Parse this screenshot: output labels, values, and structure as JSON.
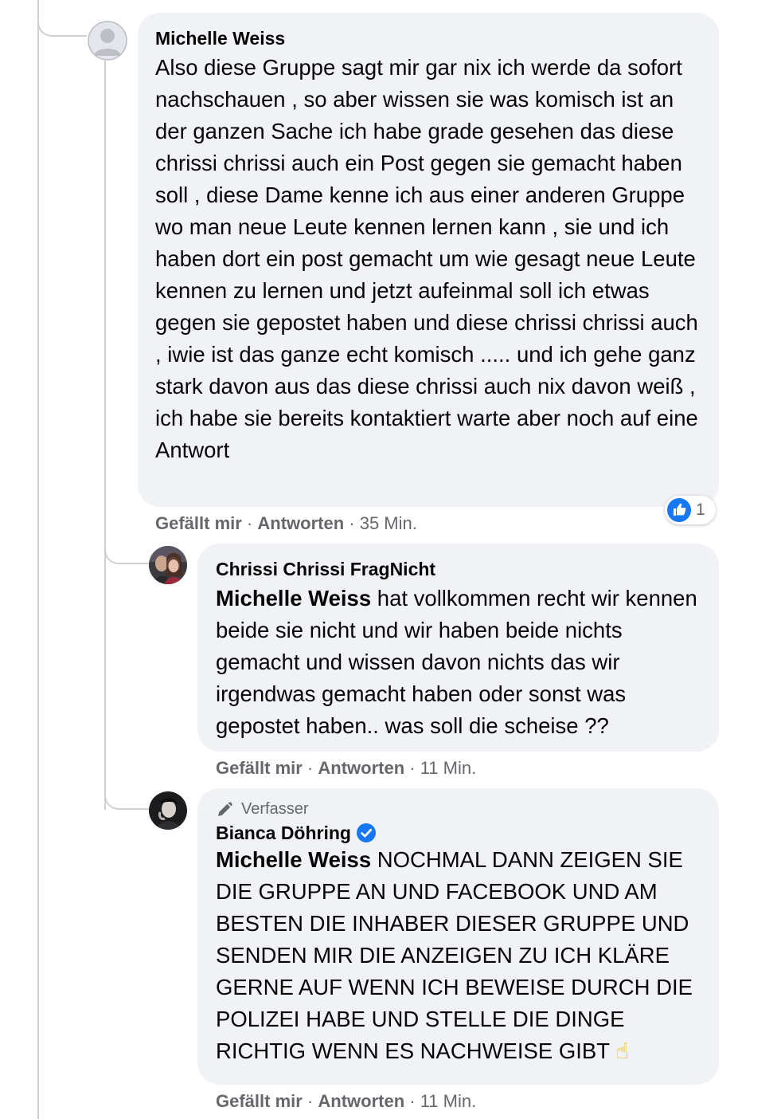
{
  "colors": {
    "bubble_bg": "#f0f2f5",
    "meta_text": "#65676b",
    "like_blue": "#1877f2",
    "verified_blue": "#1877f2",
    "thread_line": "#ced0d4"
  },
  "comments": [
    {
      "author": "Michelle Weiss",
      "mention": "",
      "text": "Also diese Gruppe sagt mir gar nix ich werde da sofort nachschauen , so aber wissen sie was komisch ist an der ganzen Sache ich habe grade gesehen das diese chrissi chrissi auch ein Post gegen sie gemacht haben soll , diese Dame kenne ich aus einer anderen Gruppe wo man neue Leute kennen lernen kann , sie und ich haben dort ein post gemacht um wie gesagt neue Leute kennen zu lernen und jetzt aufeinmal soll ich etwas gegen sie gepostet haben und diese chrissi chrissi auch , iwie ist das ganze echt komisch ..... und ich gehe ganz stark davon aus das diese chrissi auch nix davon weiß , ich habe sie bereits kontaktiert warte aber noch auf eine Antwort",
      "like_label": "Gefällt mir",
      "reply_label": "Antworten",
      "time": "35 Min.",
      "reaction_icon": "like-icon",
      "reaction_count": "1",
      "avatar_icon": "default-avatar-icon"
    },
    {
      "author": "Chrissi Chrissi FragNicht",
      "mention": "Michelle Weiss",
      "text": " hat vollkommen recht wir kennen beide sie nicht und wir haben beide nichts gemacht und wissen davon nichts das wir irgendwas gemacht haben oder sonst was gepostet haben.. was soll die scheise ??",
      "like_label": "Gefällt mir",
      "reply_label": "Antworten",
      "time": "11 Min.",
      "avatar_icon": "profile-photo-avatar"
    },
    {
      "badge_icon": "pencil-icon",
      "badge_label": "Verfasser",
      "author": "Bianca Döhring",
      "verified_icon": "verified-badge-icon",
      "mention": "Michelle Weiss",
      "text": " NOCHMAL DANN ZEIGEN SIE DIE GRUPPE AN UND FACEBOOK UND AM BESTEN DIE INHABER DIESER GRUPPE UND SENDEN MIR DIE ANZEIGEN ZU ICH KLÄRE GERNE AUF WENN ICH BEWEISE DURCH DIE POLIZEI HABE UND STELLE DIE DINGE RICHTIG WENN ES NACHWEISE GIBT",
      "emoji": "☝",
      "like_label": "Gefällt mir",
      "reply_label": "Antworten",
      "time": "11 Min.",
      "avatar_icon": "profile-photo-avatar"
    }
  ],
  "separator": " · "
}
